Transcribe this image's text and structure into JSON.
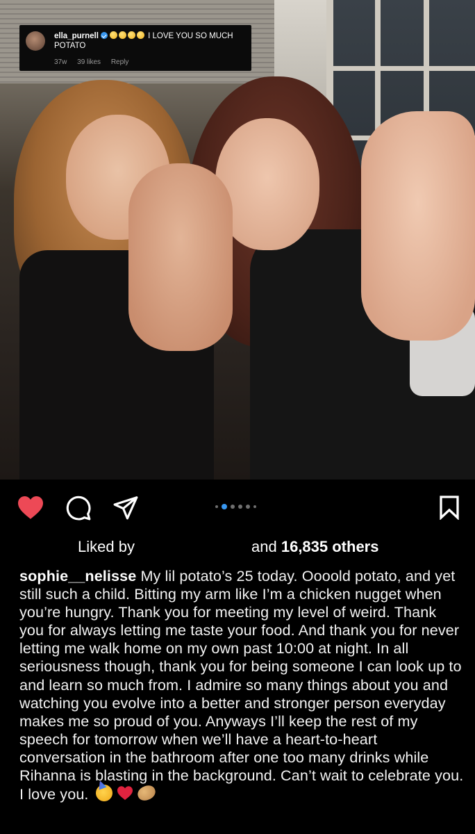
{
  "comment": {
    "username": "ella_purnell",
    "text": "I LOVE YOU SO MUCH POTATO",
    "age": "37w",
    "likes": "39 likes",
    "reply": "Reply"
  },
  "post": {
    "carousel": {
      "dot_count": 6,
      "active_index": 1
    },
    "liked": true
  },
  "likes": {
    "prefix": "Liked by",
    "suffix_pre": "and",
    "count": "16,835 others"
  },
  "caption": {
    "username": "sophie__nelisse",
    "text": "My lil potato’s 25 today. Oooold potato, and yet still such a child. Bitting my arm like I’m a chicken nugget when you’re hungry. Thank you for meeting my level of weird. Thank you for always letting me taste your food. And thank you for never letting me walk home on my own past 10:00 at night. In all seriousness though, thank you for being someone I can look up to and learn so much from. I admire so many things about you and watching you evolve into a better and stronger person everyday makes me so proud of you. Anyways I’ll keep the rest of my speech for tomorrow when we’ll have a heart-to-heart conversation in the bathroom after one too many drinks while Rihanna is blasting in the background. Can’t wait to celebrate you. I love you."
  },
  "icons": {
    "like": "heart-icon",
    "comment": "comment-icon",
    "share": "share-icon",
    "save": "bookmark-icon",
    "caption_emojis": [
      "partying-face-emoji",
      "red-heart-emoji",
      "potato-emoji"
    ]
  },
  "colors": {
    "background": "#000000",
    "like_red": "#ed4956",
    "carousel_active": "#3897f0",
    "verified_blue": "#3897f0"
  }
}
